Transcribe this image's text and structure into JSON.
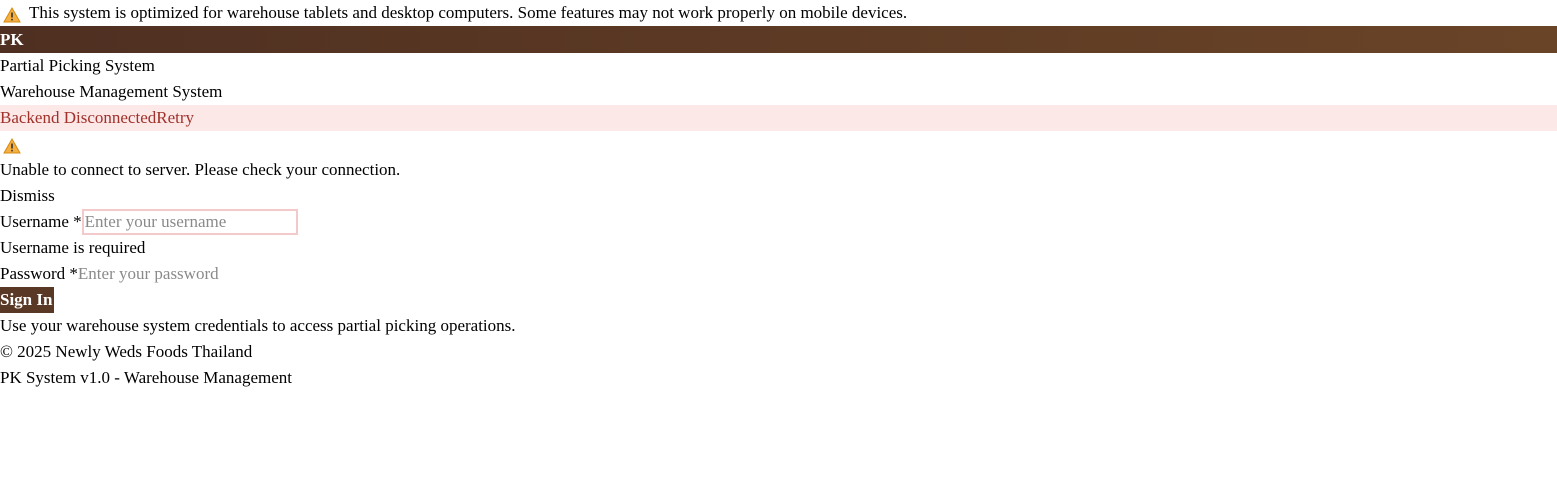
{
  "notice": {
    "icon": "warning-icon",
    "text": "This system is optimized for warehouse tablets and desktop computers. Some features may not work properly on mobile devices."
  },
  "header": {
    "logo": "PK",
    "colors": {
      "start": "#4e2f21",
      "end": "#6a4427"
    }
  },
  "app": {
    "title": "Partial Picking System",
    "subtitle": "Warehouse Management System"
  },
  "error_banner": {
    "status": "Backend Disconnected",
    "retry_label": "Retry",
    "background": "#fde8e8",
    "text_color": "#a0312b"
  },
  "alert": {
    "icon": "warning-icon",
    "message": "Unable to connect to server. Please check your connection.",
    "dismiss_label": "Dismiss"
  },
  "form": {
    "username": {
      "label": "Username *",
      "placeholder": "Enter your username",
      "value": "",
      "error": "Username is required"
    },
    "password": {
      "label": "Password *",
      "placeholder": "Enter your password",
      "value": ""
    },
    "submit_label": "Sign In",
    "help_text": "Use your warehouse system credentials to access partial picking operations."
  },
  "footer": {
    "copyright": "© 2025 Newly Weds Foods Thailand",
    "version": "PK System v1.0 - Warehouse Management"
  }
}
